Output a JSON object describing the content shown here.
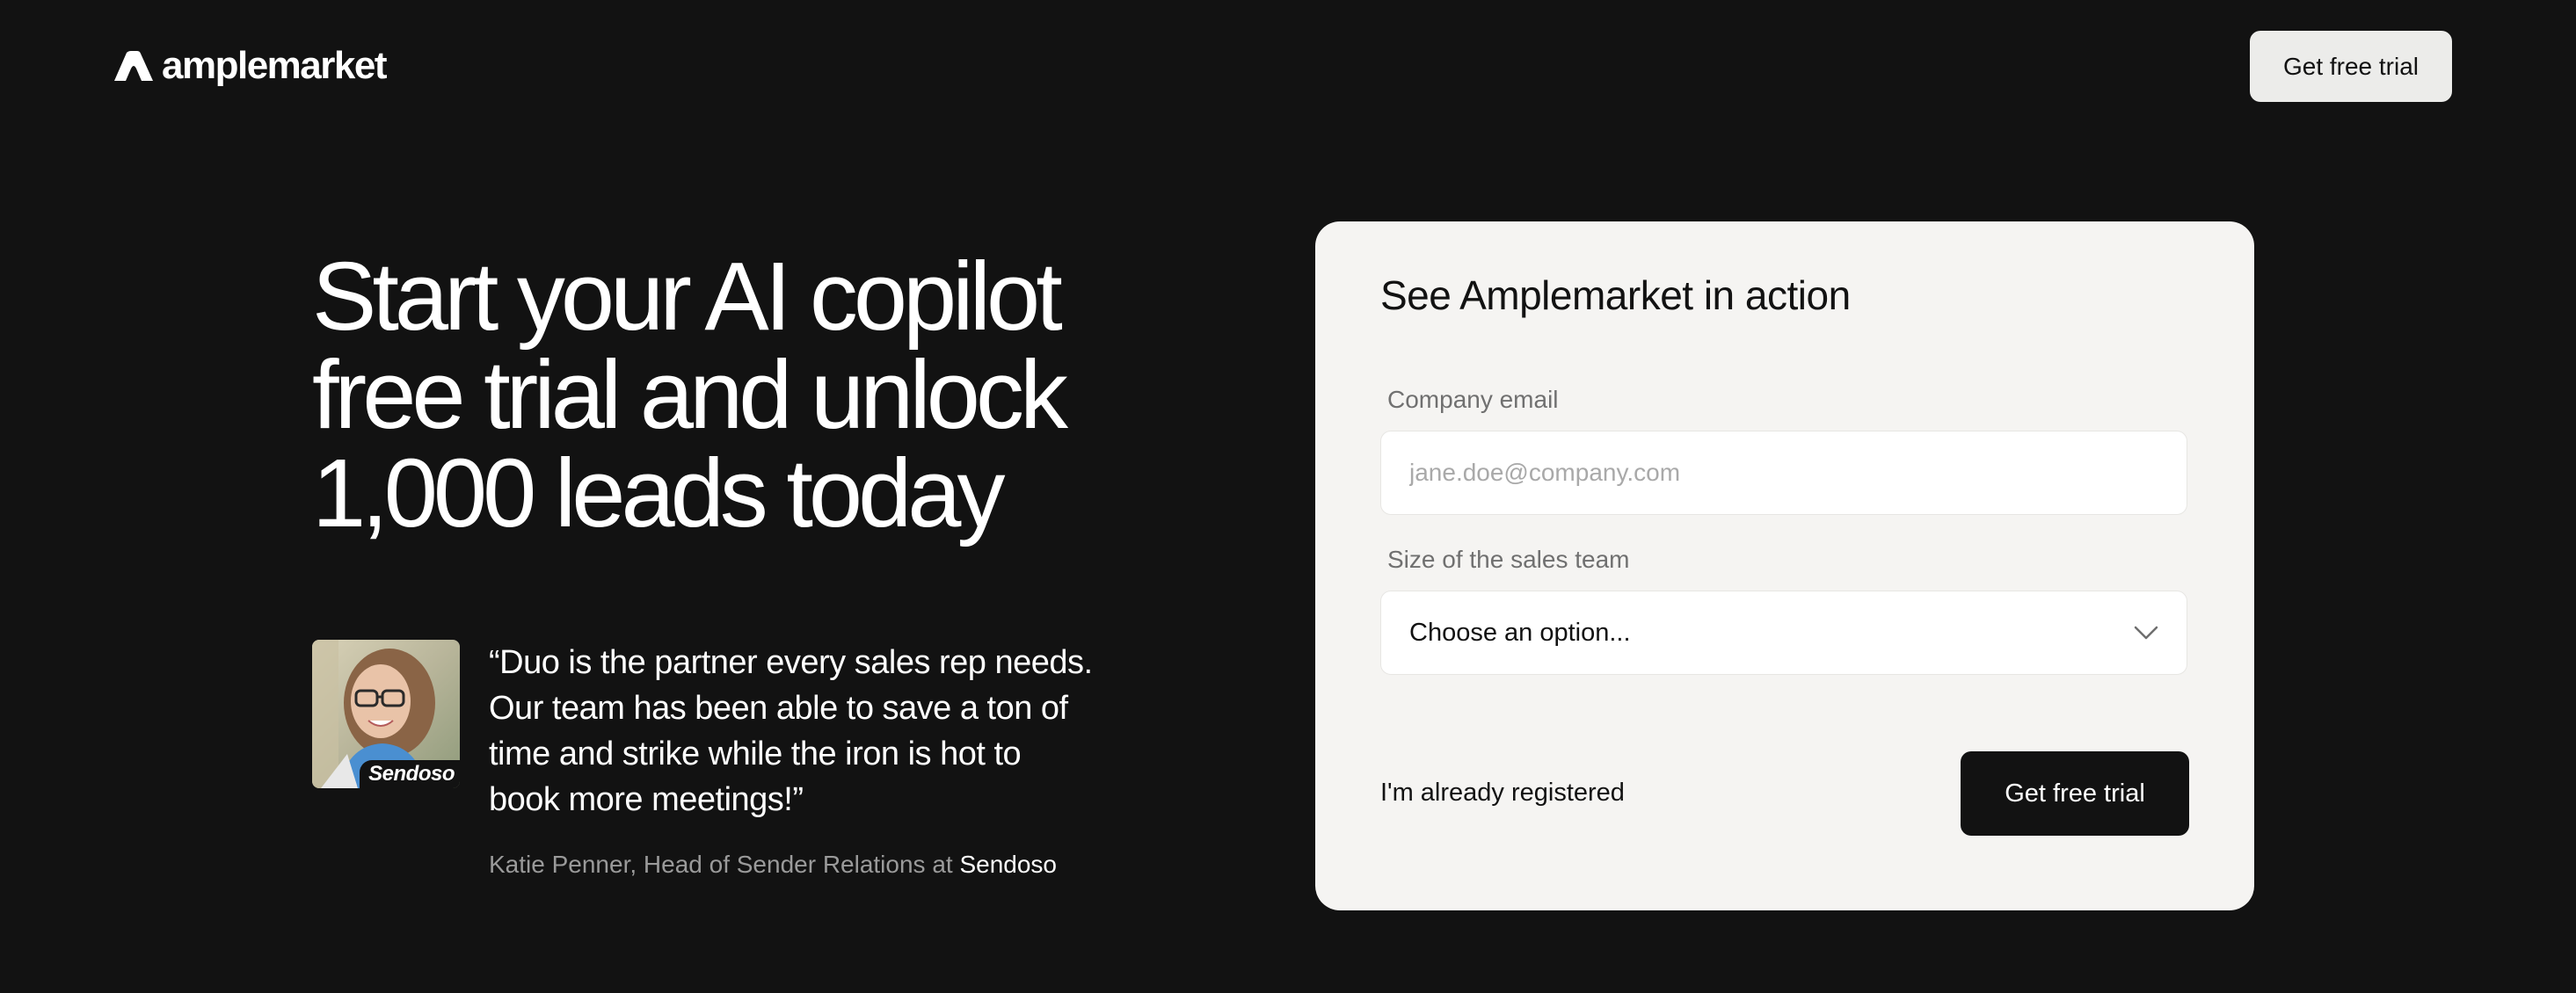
{
  "header": {
    "logo_text": "amplemarket",
    "cta_label": "Get free trial"
  },
  "hero": {
    "headline_lines": [
      "Start your AI copilot",
      "free trial and unlock",
      "1,000 leads today"
    ]
  },
  "testimonial": {
    "quote_lines": [
      "“Duo is the partner every sales rep needs.",
      "Our team has been able to save a ton of",
      "time and strike while the iron is hot to",
      "book more meetings!”"
    ],
    "author_prefix": "Katie Penner, Head of Sender Relations at",
    "company": "Sendoso",
    "avatar_badge": "Sendoso"
  },
  "form": {
    "title": "See Amplemarket in action",
    "email_label": "Company email",
    "email_placeholder": "jane.doe@company.com",
    "email_value": "",
    "size_label": "Size of the sales team",
    "size_selected": "Choose an option...",
    "already_registered": "I'm already registered",
    "submit_label": "Get free trial"
  },
  "colors": {
    "background": "#121212",
    "card": "#f5f4f2",
    "primary_button": "#121212",
    "header_button": "#ececea"
  }
}
